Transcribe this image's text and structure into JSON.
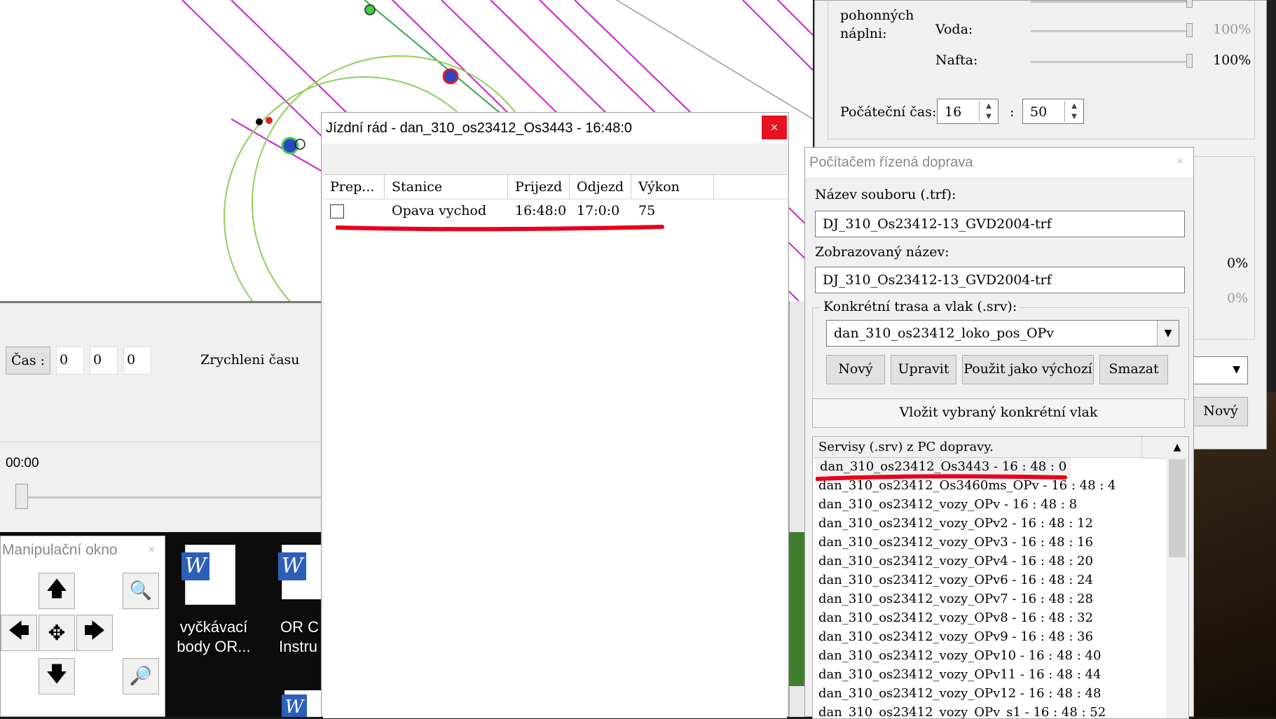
{
  "map": {
    "time_label": "Čas :",
    "time_h": "0",
    "time_m": "0",
    "time_s": "0",
    "speed_label": "Zrychleni času",
    "timeline_value": "00:00"
  },
  "manip": {
    "title": "Manipulační okno",
    "close": "×"
  },
  "desktop": {
    "icon1_label_line1": "vyčkávací",
    "icon1_label_line2": "body OR...",
    "icon2_label_line1": "OR C",
    "icon2_label_line2": "Instru"
  },
  "timetable": {
    "title": "Jízdní rád - dan_310_os23412_Os3443 - 16:48:0",
    "close": "×",
    "columns": [
      "Prep...",
      "Stanice",
      "Prijezd",
      "Odjezd",
      "Výkon"
    ],
    "rows": [
      {
        "station": "Opava vychod",
        "arrival": "16:48:0",
        "departure": "17:0:0",
        "power": "75"
      }
    ]
  },
  "fuel": {
    "label_line1": "pohonných",
    "label_line2": "náplni:",
    "rows": [
      {
        "label": "Voda:",
        "value": "100%"
      },
      {
        "label": "Nafta:",
        "value": "100%"
      }
    ],
    "levels": [
      1.0,
      1.0,
      1.0
    ],
    "start_time_label": "Počáteční čas:",
    "start_hour": "16",
    "start_minute": "50",
    "colon": ":"
  },
  "behind_right": {
    "pct1": "0%",
    "pct2": "0%",
    "new_button": "Nový"
  },
  "pc_traffic": {
    "title": "Počítačem řízená doprava",
    "close": "×",
    "file_label": "Název souboru (.trf):",
    "file_value": "DJ_310_Os23412-13_GVD2004-trf",
    "display_label": "Zobrazovaný název:",
    "display_value": "DJ_310_Os23412-13_GVD2004-trf",
    "route_group_label": "Konkrétní trasa a vlak (.srv):",
    "route_value": "dan_310_os23412_loko_pos_OPv",
    "buttons": {
      "new": "Nový",
      "edit": "Upravit",
      "use_default": "Použit jako výchozí",
      "delete": "Smazat"
    },
    "insert_button": "Vložit vybraný konkrétní vlak",
    "services_header": "Servisy (.srv) z PC dopravy.",
    "services": [
      "dan_310_os23412_Os3443 - 16 : 48 : 0",
      "dan_310_os23412_Os3460ms_OPv - 16 : 48 : 4",
      "dan_310_os23412_vozy_OPv - 16 : 48 : 8",
      "dan_310_os23412_vozy_OPv2 - 16 : 48 : 12",
      "dan_310_os23412_vozy_OPv3 - 16 : 48 : 16",
      "dan_310_os23412_vozy_OPv4 - 16 : 48 : 20",
      "dan_310_os23412_vozy_OPv6 - 16 : 48 : 24",
      "dan_310_os23412_vozy_OPv7 - 16 : 48 : 28",
      "dan_310_os23412_vozy_OPv8 - 16 : 48 : 32",
      "dan_310_os23412_vozy_OPv9 - 16 : 48 : 36",
      "dan_310_os23412_vozy_OPv10 - 16 : 48 : 40",
      "dan_310_os23412_vozy_OPv11 - 16 : 48 : 44",
      "dan_310_os23412_vozy_OPv12 - 16 : 48 : 48",
      "dan_310_os23412_vozy_OPv_s1 - 16 : 48 : 52"
    ]
  },
  "colors": {
    "highlight_underline": "#e8001a",
    "track_magenta": "#cc1fd0",
    "track_green": "#37a84a",
    "circle_green": "#8ed05a"
  }
}
